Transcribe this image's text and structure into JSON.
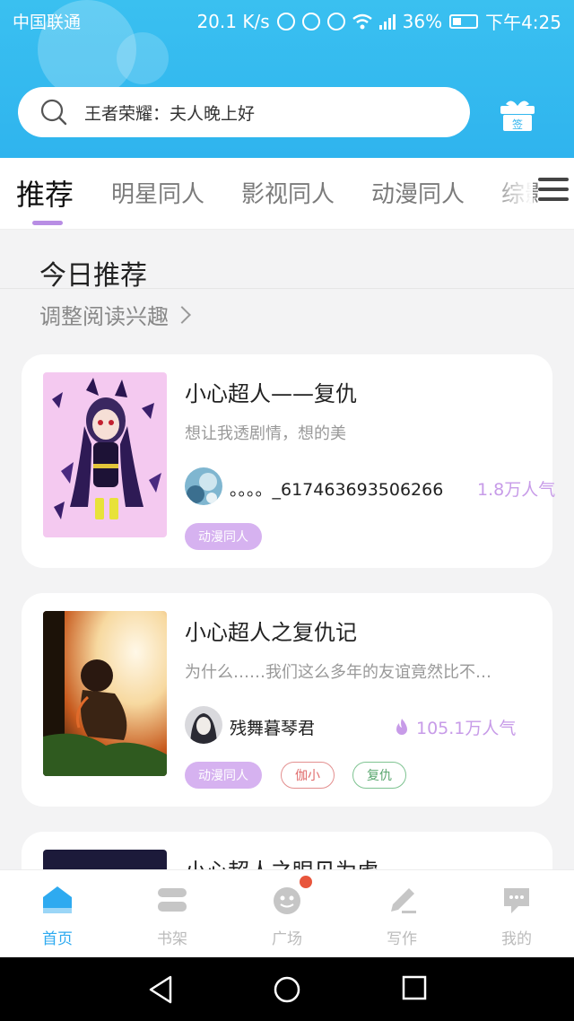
{
  "status_bar": {
    "carrier": "中国联通",
    "speed": "20.1 K/s",
    "battery": "36%",
    "time": "下午4:25"
  },
  "search": {
    "placeholder": "王者荣耀：夫人晚上好"
  },
  "gift_badge": "签",
  "tabs": [
    {
      "label": "推荐",
      "active": true
    },
    {
      "label": "明星同人",
      "active": false
    },
    {
      "label": "影视同人",
      "active": false
    },
    {
      "label": "动漫同人",
      "active": false
    },
    {
      "label": "综影",
      "active": false
    }
  ],
  "section": {
    "title": "今日推荐",
    "adjust_label": "调整阅读兴趣"
  },
  "books": [
    {
      "title": "小心超人——复仇",
      "description": "想让我透剧情，想的美",
      "author": "。。。。_617463693506266",
      "popularity": "1.8万人气",
      "tags": [
        {
          "label": "动漫同人",
          "style": "fill"
        }
      ]
    },
    {
      "title": "小心超人之复仇记",
      "description": "为什么……我们这么多年的友谊竟然比不…",
      "author": "残舞暮琴君",
      "popularity": "105.1万人气",
      "tags": [
        {
          "label": "动漫同人",
          "style": "fill"
        },
        {
          "label": "伽小",
          "style": "red"
        },
        {
          "label": "复仇",
          "style": "green"
        }
      ]
    },
    {
      "title": "小心超人之眼见为虚"
    }
  ],
  "bottom_nav": [
    {
      "label": "首页",
      "icon": "home-icon",
      "active": true
    },
    {
      "label": "书架",
      "icon": "bookshelf-icon",
      "active": false
    },
    {
      "label": "广场",
      "icon": "square-icon",
      "active": false
    },
    {
      "label": "写作",
      "icon": "write-icon",
      "active": false
    },
    {
      "label": "我的",
      "icon": "profile-icon",
      "active": false
    }
  ],
  "colors": {
    "header": "#2fb4ee",
    "accent_purple": "#c79be8",
    "nav_active": "#2eaaf0",
    "badge_dot": "#e8553c"
  }
}
